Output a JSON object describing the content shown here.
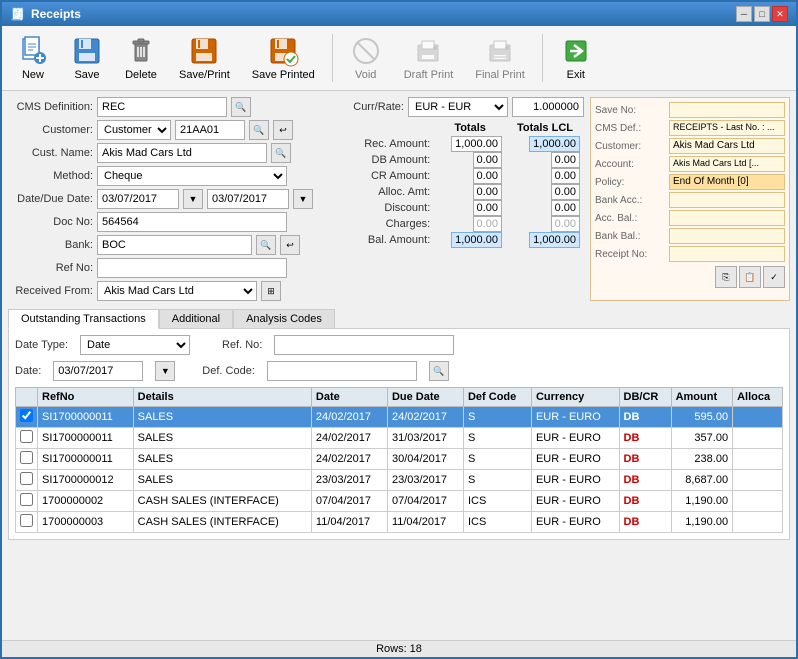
{
  "window": {
    "title": "Receipts"
  },
  "toolbar": {
    "new_label": "New",
    "save_label": "Save",
    "delete_label": "Delete",
    "saveprint_label": "Save/Print",
    "saveprinted_label": "Save Printed",
    "void_label": "Void",
    "draftprint_label": "Draft Print",
    "finalprint_label": "Final Print",
    "exit_label": "Exit"
  },
  "form": {
    "cms_definition_label": "CMS Definition:",
    "cms_definition_value": "REC",
    "customer_label": "Customer:",
    "customer_type": "Customer",
    "customer_code": "21AA01",
    "cust_name_label": "Cust. Name:",
    "cust_name_value": "Akis Mad Cars Ltd",
    "method_label": "Method:",
    "method_value": "Cheque",
    "date_label": "Date/Due Date:",
    "date_value": "03/07/2017",
    "due_date_value": "03/07/2017",
    "doc_no_label": "Doc No:",
    "doc_no_value": "564564",
    "bank_label": "Bank:",
    "bank_value": "BOC",
    "ref_no_label": "Ref No:",
    "ref_no_value": "",
    "received_from_label": "Received From:",
    "received_from_value": "Akis Mad Cars Ltd"
  },
  "currency": {
    "label": "Curr/Rate:",
    "value": "EUR - EUR",
    "rate": "1.000000"
  },
  "totals": {
    "totals_label": "Totals",
    "totals_lcl_label": "Totals LCL",
    "rec_amount_label": "Rec. Amount:",
    "rec_amount": "1,000.00",
    "rec_amount_lcl": "1,000.00",
    "db_amount_label": "DB Amount:",
    "db_amount": "0.00",
    "db_amount_lcl": "0.00",
    "cr_amount_label": "CR Amount:",
    "cr_amount": "0.00",
    "cr_amount_lcl": "0.00",
    "alloc_amt_label": "Alloc. Amt:",
    "alloc_amt": "0.00",
    "alloc_amt_lcl": "0.00",
    "discount_label": "Discount:",
    "discount": "0.00",
    "discount_lcl": "0.00",
    "charges_label": "Charges:",
    "charges": "0.00",
    "charges_lcl": "0.00",
    "bal_amount_label": "Bal. Amount:",
    "bal_amount": "1,000.00",
    "bal_amount_lcl": "1,000.00"
  },
  "info_panel": {
    "save_no_label": "Save No:",
    "save_no_value": "",
    "cms_def_label": "CMS Def.:",
    "cms_def_value": "RECEIPTS - Last No. : ...",
    "customer_label": "Customer:",
    "customer_value": "Akis Mad Cars Ltd",
    "account_label": "Account:",
    "account_value": "Akis Mad Cars Ltd [...",
    "policy_label": "Policy:",
    "policy_value": "End Of Month [0]",
    "bank_acc_label": "Bank Acc.:",
    "bank_acc_value": "",
    "acc_bal_label": "Acc. Bal.:",
    "acc_bal_value": "",
    "bank_bal_label": "Bank Bal.:",
    "bank_bal_value": "",
    "receipt_no_label": "Receipt No:",
    "receipt_no_value": ""
  },
  "tabs": {
    "outstanding_label": "Outstanding Transactions",
    "additional_label": "Additional",
    "analysis_label": "Analysis Codes"
  },
  "filter": {
    "date_type_label": "Date Type:",
    "date_type_value": "Date",
    "date_label": "Date:",
    "date_value": "03/07/2017",
    "ref_no_label": "Ref. No:",
    "ref_no_value": "",
    "def_code_label": "Def. Code:",
    "def_code_value": ""
  },
  "table": {
    "headers": [
      "",
      "RefNo",
      "Details",
      "Date",
      "Due Date",
      "Def Code",
      "Currency",
      "DB/CR",
      "Amount",
      "Alloca"
    ],
    "rows": [
      {
        "selected": true,
        "checked": true,
        "refno": "SI1700000011",
        "details": "SALES",
        "date": "24/02/2017",
        "due_date": "24/02/2017",
        "def_code": "S",
        "currency": "EUR - EURO",
        "dbcr": "DB",
        "amount": "595.00",
        "alloc": ""
      },
      {
        "selected": false,
        "checked": false,
        "refno": "SI1700000011",
        "details": "SALES",
        "date": "24/02/2017",
        "due_date": "31/03/2017",
        "def_code": "S",
        "currency": "EUR - EURO",
        "dbcr": "DB",
        "amount": "357.00",
        "alloc": ""
      },
      {
        "selected": false,
        "checked": false,
        "refno": "SI1700000011",
        "details": "SALES",
        "date": "24/02/2017",
        "due_date": "30/04/2017",
        "def_code": "S",
        "currency": "EUR - EURO",
        "dbcr": "DB",
        "amount": "238.00",
        "alloc": ""
      },
      {
        "selected": false,
        "checked": false,
        "refno": "SI1700000012",
        "details": "SALES",
        "date": "23/03/2017",
        "due_date": "23/03/2017",
        "def_code": "S",
        "currency": "EUR - EURO",
        "dbcr": "DB",
        "amount": "8,687.00",
        "alloc": ""
      },
      {
        "selected": false,
        "checked": false,
        "refno": "1700000002",
        "details": "CASH SALES (INTERFACE)",
        "date": "07/04/2017",
        "due_date": "07/04/2017",
        "def_code": "ICS",
        "currency": "EUR - EURO",
        "dbcr": "DB",
        "amount": "1,190.00",
        "alloc": ""
      },
      {
        "selected": false,
        "checked": false,
        "refno": "1700000003",
        "details": "CASH SALES (INTERFACE)",
        "date": "11/04/2017",
        "due_date": "11/04/2017",
        "def_code": "ICS",
        "currency": "EUR - EURO",
        "dbcr": "DB",
        "amount": "1,190.00",
        "alloc": ""
      }
    ]
  },
  "status_bar": {
    "rows_label": "Rows: 18"
  }
}
